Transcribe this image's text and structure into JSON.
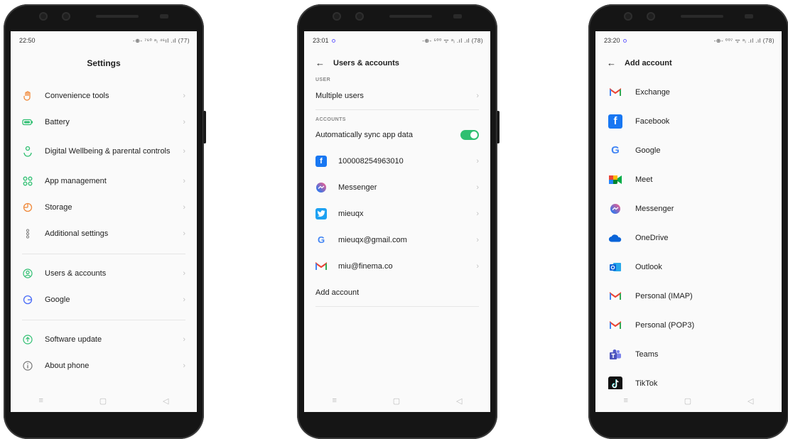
{
  "phone1": {
    "time": "22:50",
    "status_icons": "-⊕- ⁷⁶⁰ ᵊᵢ ⁴⁶ıl .ıl (77)",
    "title": "Settings",
    "items": [
      {
        "label": "Convenience tools",
        "icon": "hand-icon"
      },
      {
        "label": "Battery",
        "icon": "battery-icon"
      },
      {
        "label": "Digital Wellbeing & parental controls",
        "icon": "wellbeing-icon"
      },
      {
        "label": "App management",
        "icon": "apps-grid-icon"
      },
      {
        "label": "Storage",
        "icon": "storage-icon"
      },
      {
        "label": "Additional settings",
        "icon": "dots-icon"
      }
    ],
    "items2": [
      {
        "label": "Users & accounts",
        "icon": "user-icon"
      },
      {
        "label": "Google",
        "icon": "google-icon"
      }
    ],
    "items3": [
      {
        "label": "Software update",
        "icon": "update-icon"
      },
      {
        "label": "About phone",
        "icon": "info-icon"
      }
    ],
    "nav": [
      "≡",
      "▢",
      "◁"
    ]
  },
  "phone2": {
    "time": "23:01",
    "status_icons": "-⊕- ⁵⁰⁰ ᯤ ᵊᵢ .ıl .ıl (78)",
    "title": "Users & accounts",
    "section_user": "USER",
    "multiple_users": "Multiple users",
    "section_accounts": "ACCOUNTS",
    "auto_sync": "Automatically sync app data",
    "accounts": [
      {
        "label": "100008254963010",
        "icon": "facebook-icon"
      },
      {
        "label": "Messenger",
        "icon": "messenger-icon"
      },
      {
        "label": "mieuqx",
        "icon": "twitter-icon"
      },
      {
        "label": "mieuqx@gmail.com",
        "icon": "google-icon"
      },
      {
        "label": "miu@finema.co",
        "icon": "gmail-icon"
      }
    ],
    "add_account": "Add account",
    "nav": [
      "≡",
      "▢",
      "◁"
    ]
  },
  "phone3": {
    "time": "23:20",
    "status_icons": "-⊕- ⁰⁰⁷ ᯤ ᵊᵢ .ıl .ıl (78)",
    "title": "Add account",
    "accounts": [
      {
        "label": "Exchange",
        "icon": "gmail-icon"
      },
      {
        "label": "Facebook",
        "icon": "facebook-icon"
      },
      {
        "label": "Google",
        "icon": "google-icon"
      },
      {
        "label": "Meet",
        "icon": "meet-icon"
      },
      {
        "label": "Messenger",
        "icon": "messenger-icon"
      },
      {
        "label": "OneDrive",
        "icon": "onedrive-icon"
      },
      {
        "label": "Outlook",
        "icon": "outlook-icon"
      },
      {
        "label": "Personal (IMAP)",
        "icon": "gmail-icon"
      },
      {
        "label": "Personal (POP3)",
        "icon": "gmail-icon"
      },
      {
        "label": "Teams",
        "icon": "teams-icon"
      },
      {
        "label": "TikTok",
        "icon": "tiktok-icon"
      }
    ],
    "nav": [
      "≡",
      "▢",
      "◁"
    ]
  },
  "chevron": "›",
  "back_arrow": "←",
  "colors": {
    "toggle_on": "#2fbf71",
    "accent": "#6c63ff",
    "facebook": "#1877f2",
    "twitter": "#1da1f2"
  }
}
